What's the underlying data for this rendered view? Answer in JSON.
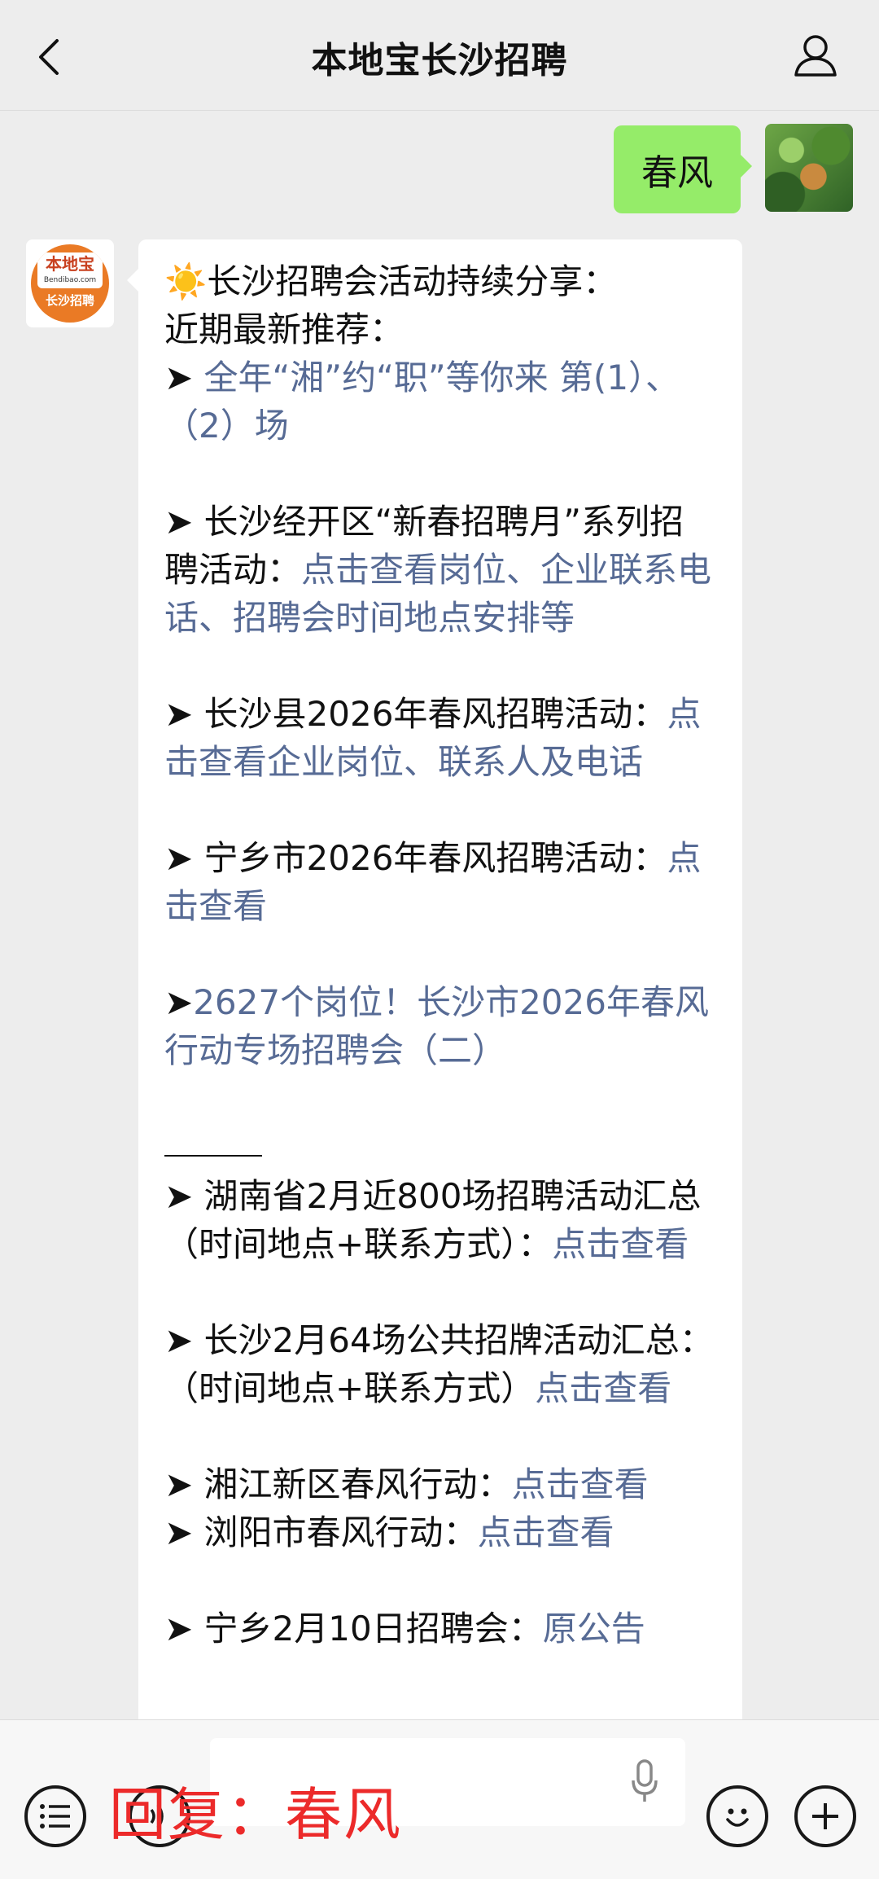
{
  "header": {
    "title": "本地宝长沙招聘"
  },
  "my_message": {
    "text": "春风"
  },
  "bot": {
    "logo_main": "本地宝",
    "logo_sub": "Bendibao.com",
    "logo_foot": "长沙招聘",
    "intro_sun": "☀️",
    "intro": "长沙招聘会活动持续分享：",
    "recommend": "近期最新推荐：",
    "items": [
      {
        "arrow": "➤ ",
        "text": "",
        "link": "全年“湘”约“职”等你来 第(1）、（2）场"
      },
      {
        "arrow": "➤ ",
        "text": "长沙经开区“新春招聘月”系列招聘活动：",
        "link": "点击查看岗位、企业联系电话、招聘会时间地点安排等"
      },
      {
        "arrow": "➤ ",
        "text": "长沙县2026年春风招聘活动：",
        "link": "点击查看企业岗位、联系人及电话"
      },
      {
        "arrow": "➤ ",
        "text": "宁乡市2026年春风招聘活动：",
        "link": "点击查看"
      },
      {
        "arrow": "➤",
        "text": "",
        "link": "2627个岗位！长沙市2026年春风行动专场招聘会（二）"
      }
    ],
    "items2": [
      {
        "arrow": "➤ ",
        "text": "湖南省2月近800场招聘活动汇总（时间地点+联系方式）：",
        "link": "点击查看"
      },
      {
        "arrow": "➤ ",
        "text": "长沙2月64场公共招牌活动汇总：（时间地点+联系方式）",
        "link": "点击查看"
      }
    ],
    "items3": [
      {
        "arrow": "➤ ",
        "text": "湘江新区春风行动：",
        "link": "点击查看"
      },
      {
        "arrow": "➤ ",
        "text": "浏阳市春风行动：",
        "link": "点击查看"
      },
      {
        "arrow": "➤ ",
        "text": "宁乡2月10日招聘会：",
        "link": "原公告"
      }
    ]
  },
  "bottom": {
    "overlay_text": "回复：春风"
  },
  "colors": {
    "link": "#576b95",
    "my_bubble": "#95ec69",
    "overlay": "#ec2a2a"
  }
}
